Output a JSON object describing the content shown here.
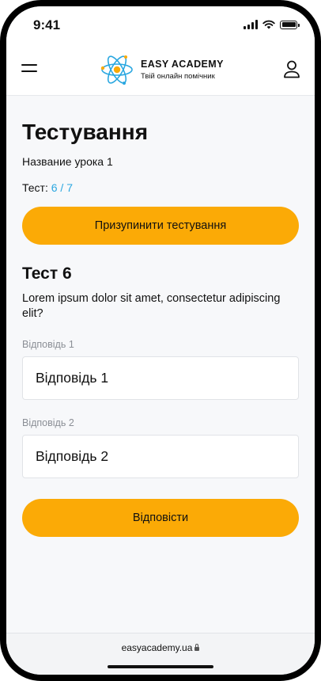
{
  "status_bar": {
    "time": "9:41",
    "icons": [
      "signal-icon",
      "wifi-icon",
      "battery-icon"
    ]
  },
  "header": {
    "brand": "EASY ACADEMY",
    "tagline": "Твій онлайн помічник",
    "icons": [
      "menu-icon",
      "atom-logo-icon",
      "user-icon"
    ]
  },
  "page": {
    "title": "Тестування",
    "lesson_name": "Название урока 1",
    "progress_label": "Тест:",
    "progress_value": "6 / 7",
    "pause_button": "Призупинити тестування"
  },
  "question": {
    "title": "Тест 6",
    "text": "Lorem ipsum dolor sit amet, consectetur adipiscing elit?",
    "options": [
      {
        "label": "Відповідь 1",
        "value": "Відповідь 1"
      },
      {
        "label": "Відповідь 2",
        "value": "Відповідь 2"
      }
    ],
    "submit_button": "Відповісти"
  },
  "browser": {
    "url": "easyacademy.ua"
  },
  "colors": {
    "accent": "#fbaa06",
    "link": "#2aa7e0",
    "background": "#f7f8fa",
    "muted_text": "#8b8f96"
  }
}
